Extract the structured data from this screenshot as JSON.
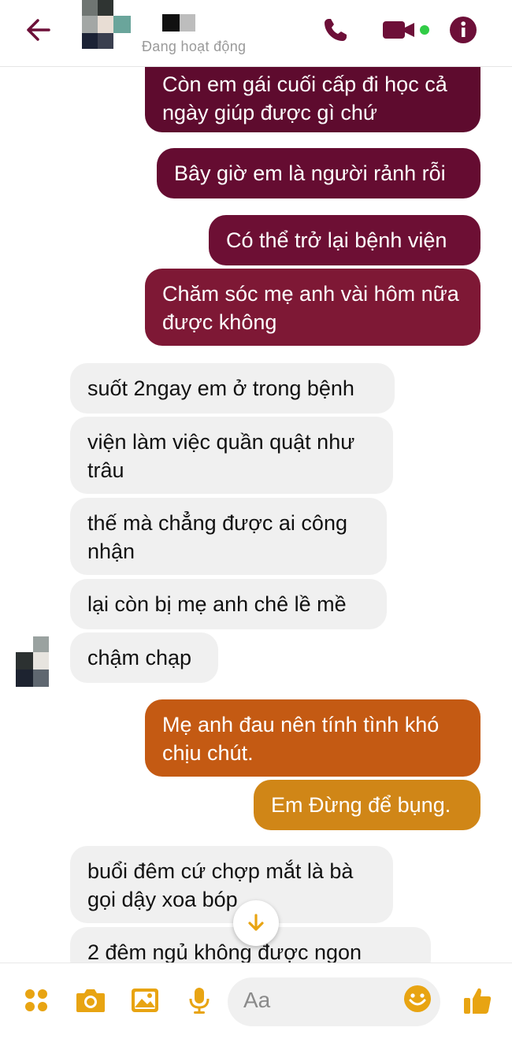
{
  "header": {
    "status_text": "Đang hoạt động",
    "accent_color": "#6d0f38"
  },
  "messages": {
    "sent": [
      {
        "text": "Còn em gái cuối cấp đi học cả ngày giúp được gì chứ",
        "color": "#5e0b2e"
      },
      {
        "text": "Bây giờ em là người rảnh rỗi",
        "color": "#650c31"
      },
      {
        "text": "Có thể trở lại bệnh viện",
        "color": "#6d0f34"
      },
      {
        "text": "Chăm sóc mẹ anh vài hôm nữa được không",
        "color": "#7e1835"
      },
      {
        "text": "Mẹ anh đau nên tính tình khó chịu chút.",
        "color": "#c45a13"
      },
      {
        "text": "Em Đừng để bụng.",
        "color": "#d08617"
      }
    ],
    "received": [
      {
        "text": "suốt 2ngay em ở trong bệnh"
      },
      {
        "text": "viện làm việc quần quật như trâu"
      },
      {
        "text": "thế mà chẳng được ai công nhận"
      },
      {
        "text": "lại còn bị mẹ anh chê lề mề"
      },
      {
        "text": "chậm chạp"
      },
      {
        "text": "buổi đêm cứ chợp mắt là bà gọi dậy xoa bóp"
      },
      {
        "text": "2 đêm ngủ không được ngon"
      }
    ]
  },
  "composer": {
    "placeholder": "Aa",
    "icon_color": "#e8a412"
  }
}
